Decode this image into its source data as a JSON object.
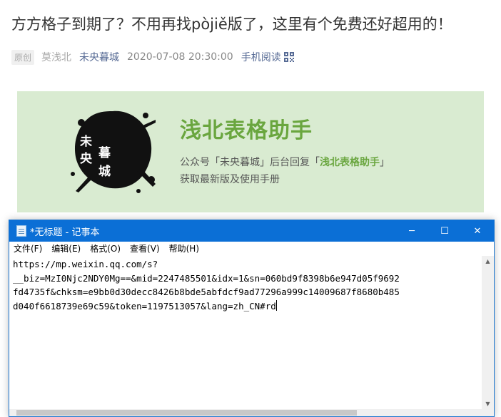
{
  "article": {
    "title": "方方格子到期了？不用再找pòjiě版了，这里有个免费还好超用的！",
    "original_badge": "原创",
    "author": "莫浅北",
    "account": "未央暮城",
    "datetime": "2020-07-08 20:30:00",
    "mobile_read": "手机阅读"
  },
  "banner": {
    "logo_chars": [
      "未",
      "央",
      "暮",
      "城"
    ],
    "title": "浅北表格助手",
    "desc_prefix": "公众号「未央暮城」后台回复「",
    "desc_keyword": "浅北表格助手",
    "desc_suffix": "」",
    "desc_line2": "获取最新版及使用手册",
    "colors": {
      "background": "#d9ebd1",
      "accent": "#6aa63f"
    }
  },
  "notepad": {
    "title": "*无标题 - 记事本",
    "controls": {
      "minimize": "─",
      "maximize": "☐",
      "close": "✕"
    },
    "menus": [
      "文件(F)",
      "编辑(E)",
      "格式(O)",
      "查看(V)",
      "帮助(H)"
    ],
    "lines": [
      "https://mp.weixin.qq.com/s?",
      "__biz=MzI0Njc2NDY0Mg==&mid=2247485501&idx=1&sn=060bd9f8398b6e947d05f9692",
      "fd4735f&chksm=e9bb0d30decc8426b8bde5abfdcf9ad77296a999c14009687f8680b485",
      "d040f6618739e69c59&token=1197513057&lang=zh_CN#rd"
    ],
    "accent": "#0b6fd6"
  }
}
